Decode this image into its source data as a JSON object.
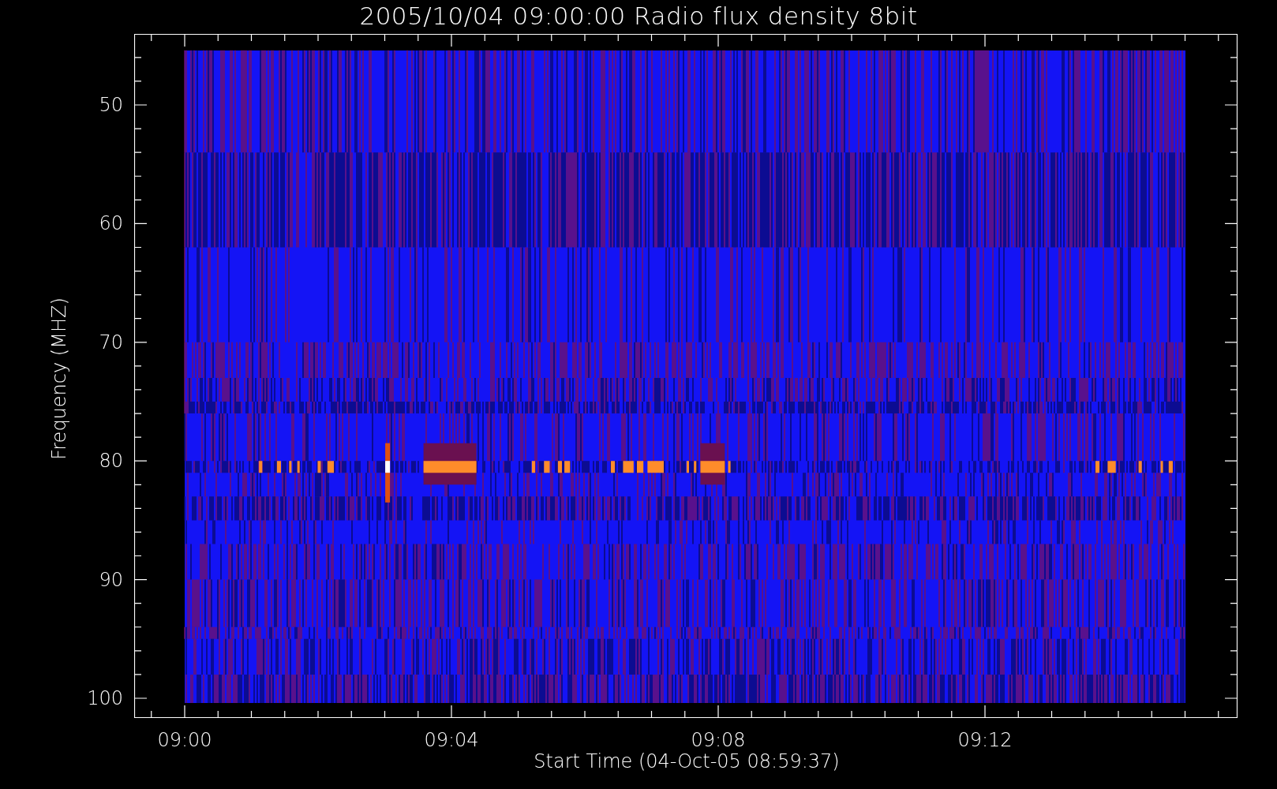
{
  "title": "2005/10/04 09:00:00 Radio flux density 8bit",
  "y_axis": {
    "label": "Frequency (MHZ)",
    "ticks": [
      "50",
      "60",
      "70",
      "80",
      "90",
      "100"
    ]
  },
  "x_axis": {
    "label": "Start Time (04-Oct-05 08:59:37)",
    "ticks": [
      "09:00",
      "09:04",
      "09:08",
      "09:12"
    ]
  }
}
